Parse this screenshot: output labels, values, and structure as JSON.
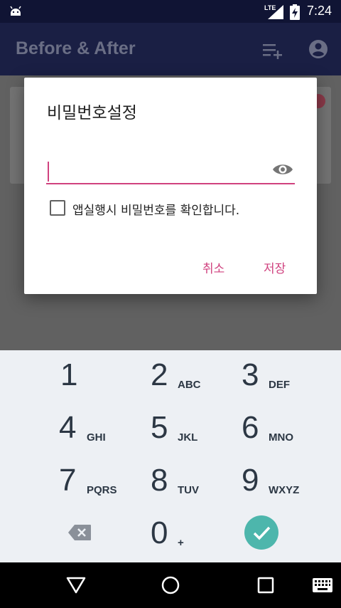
{
  "status_bar": {
    "network": "LTE",
    "time": "7:24"
  },
  "app_bar": {
    "title": "Before & After"
  },
  "dialog": {
    "title": "비밀번호설정",
    "password_value": "",
    "checkbox_label": "앱실행시 비밀번호를 확인합니다.",
    "checkbox_checked": false,
    "cancel_label": "취소",
    "save_label": "저장"
  },
  "keypad": {
    "keys": [
      {
        "digit": "1",
        "letters": ""
      },
      {
        "digit": "2",
        "letters": "ABC"
      },
      {
        "digit": "3",
        "letters": "DEF"
      },
      {
        "digit": "4",
        "letters": "GHI"
      },
      {
        "digit": "5",
        "letters": "JKL"
      },
      {
        "digit": "6",
        "letters": "MNO"
      },
      {
        "digit": "7",
        "letters": "PQRS"
      },
      {
        "digit": "8",
        "letters": "TUV"
      },
      {
        "digit": "9",
        "letters": "WXYZ"
      },
      {
        "digit": "0",
        "letters": "+"
      }
    ],
    "done_color": "#4db6ac"
  },
  "colors": {
    "accent": "#d0427f",
    "app_bar": "#1a1f44",
    "keypad_bg": "#edf0f4"
  }
}
